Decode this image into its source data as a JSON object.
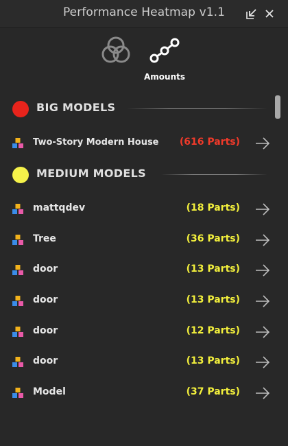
{
  "window": {
    "title": "Performance Heatmap v1.1"
  },
  "modes": [
    {
      "label": "",
      "icon": "venn-circles-icon"
    },
    {
      "label": "Amounts",
      "icon": "nodes-graph-icon"
    }
  ],
  "colors": {
    "big": "#e8241c",
    "medium": "#f5f24a",
    "big_text": "#f03a2a",
    "medium_text": "#f2ef3c"
  },
  "sections": {
    "big": {
      "title": "BIG MODELS",
      "items": [
        {
          "name": "Two-Story Modern House",
          "count": "(616 Parts)"
        }
      ]
    },
    "medium": {
      "title": "MEDIUM MODELS",
      "items": [
        {
          "name": "mattqdev",
          "count": "(18 Parts)"
        },
        {
          "name": "Tree",
          "count": "(36 Parts)"
        },
        {
          "name": "door",
          "count": "(13 Parts)"
        },
        {
          "name": "door",
          "count": "(13 Parts)"
        },
        {
          "name": "door",
          "count": "(12 Parts)"
        },
        {
          "name": "door",
          "count": "(13 Parts)"
        },
        {
          "name": "Model",
          "count": "(37 Parts)"
        }
      ]
    }
  }
}
